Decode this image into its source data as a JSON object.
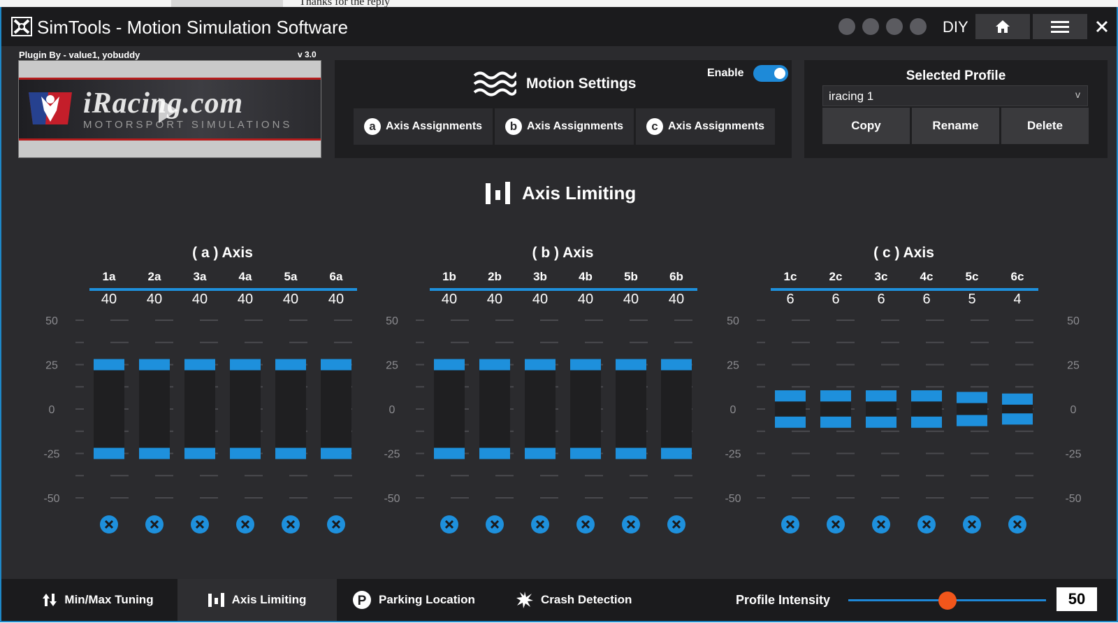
{
  "background_page": {
    "text": "Thanks for the reply"
  },
  "window": {
    "title": "SimTools - Motion Simulation Software",
    "diy_label": "DIY",
    "icons": [
      "download-icon",
      "gear-icon",
      "wrench-icon",
      "power-icon",
      "home-icon",
      "menu-icon",
      "close-icon"
    ]
  },
  "plugin": {
    "by": "Plugin By - value1, yobuddy",
    "version": "v 3.0",
    "image_logo_text": "iRacing.com",
    "image_sub_text": "MOTORSPORT SIMULATIONS"
  },
  "motion_settings": {
    "title": "Motion Settings",
    "enable_label": "Enable",
    "enabled": true,
    "axis_buttons": [
      {
        "badge": "a",
        "label": "Axis Assignments"
      },
      {
        "badge": "b",
        "label": "Axis Assignments"
      },
      {
        "badge": "c",
        "label": "Axis Assignments"
      }
    ]
  },
  "profile": {
    "title": "Selected Profile",
    "selected": "iracing 1",
    "chevron": "v",
    "buttons": [
      "Copy",
      "Rename",
      "Delete"
    ]
  },
  "axis_limiting": {
    "title": "Axis Limiting",
    "scale": [
      50,
      25,
      0,
      -25,
      -50
    ],
    "ylim": [
      -50,
      50
    ],
    "groups": [
      {
        "title": "( a ) Axis",
        "axes": [
          {
            "name": "1a",
            "value": 40
          },
          {
            "name": "2a",
            "value": 40
          },
          {
            "name": "3a",
            "value": 40
          },
          {
            "name": "4a",
            "value": 40
          },
          {
            "name": "5a",
            "value": 40
          },
          {
            "name": "6a",
            "value": 40
          }
        ]
      },
      {
        "title": "( b ) Axis",
        "axes": [
          {
            "name": "1b",
            "value": 40
          },
          {
            "name": "2b",
            "value": 40
          },
          {
            "name": "3b",
            "value": 40
          },
          {
            "name": "4b",
            "value": 40
          },
          {
            "name": "5b",
            "value": 40
          },
          {
            "name": "6b",
            "value": 40
          }
        ]
      },
      {
        "title": "( c ) Axis",
        "axes": [
          {
            "name": "1c",
            "value": 6
          },
          {
            "name": "2c",
            "value": 6
          },
          {
            "name": "3c",
            "value": 6
          },
          {
            "name": "4c",
            "value": 6
          },
          {
            "name": "5c",
            "value": 5
          },
          {
            "name": "6c",
            "value": 4
          }
        ]
      }
    ]
  },
  "bottom_tabs": [
    {
      "label": "Min/Max Tuning",
      "icon": "arrows-updown-icon",
      "active": false
    },
    {
      "label": "Axis Limiting",
      "icon": "bars-icon",
      "active": true
    },
    {
      "label": "Parking Location",
      "icon": "parking-icon",
      "active": false
    },
    {
      "label": "Crash Detection",
      "icon": "crash-icon",
      "active": false
    }
  ],
  "profile_intensity": {
    "label": "Profile Intensity",
    "value": "50",
    "min": 0,
    "max": 100,
    "level": 50
  },
  "colors": {
    "accent": "#1e90dc",
    "slider_knob": "#f2561b",
    "panel": "#1e1e20",
    "background": "#2b2b2e"
  }
}
